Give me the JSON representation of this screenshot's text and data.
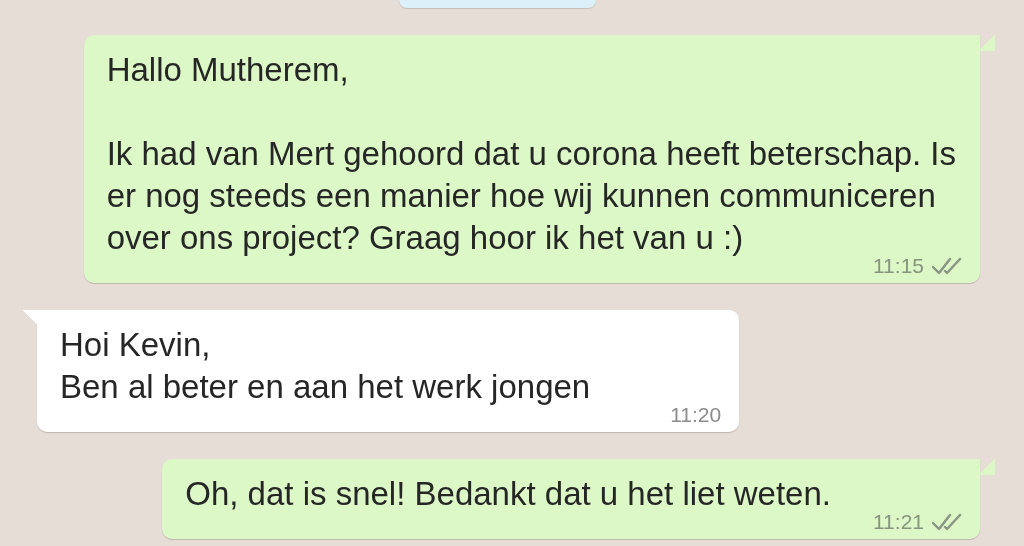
{
  "date_chip": {
    "kind": "chip"
  },
  "messages": [
    {
      "outgoing": true,
      "text": "Hallo Mutherem,\n\nIk had van Mert gehoord dat u corona heeft beterschap. Is\ner nog steeds een manier hoe wij kunnen communiceren\nover ons project? Graag hoor ik het van u :)",
      "time": "11:15",
      "read": false
    },
    {
      "outgoing": false,
      "text": "Hoi Kevin,\nBen al beter en aan het werk jongen",
      "time": "11:20"
    },
    {
      "outgoing": true,
      "text": "Oh, dat is snel! Bedankt dat u het liet weten.",
      "time": "11:21",
      "read": false
    }
  ]
}
